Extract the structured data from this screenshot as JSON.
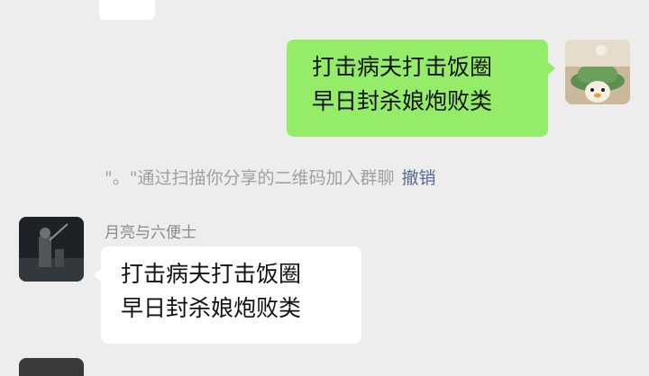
{
  "messages": [
    {
      "side": "right",
      "text": "打击病夫打击饭圈\n早日封杀娘炮败类"
    },
    {
      "side": "left",
      "sender": "月亮与六便士",
      "text": "打击病夫打击饭圈\n早日封杀娘炮败类"
    }
  ],
  "system": {
    "text": "\"。\"通过扫描你分享的二维码加入群聊",
    "action": "撤销"
  },
  "colors": {
    "background": "#ededed",
    "self_bubble": "#95ec69",
    "other_bubble": "#ffffff",
    "link": "#576b95"
  }
}
